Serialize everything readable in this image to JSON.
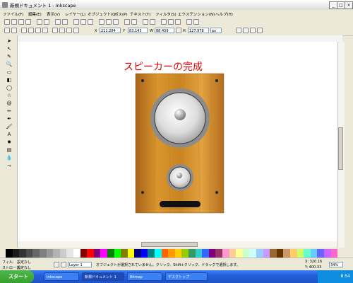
{
  "window": {
    "title": "新規ドキュメント 1 - Inkscape"
  },
  "menu": [
    "ファイル(F)",
    "編集(E)",
    "表示(V)",
    "レイヤー(L)",
    "オブジェクト(O)",
    "パス(P)",
    "テキスト(T)",
    "フィルタ(S)",
    "エクステンション(N)",
    "ヘルプ(H)"
  ],
  "toolbar2": {
    "x_label": "X",
    "x_value": "211.284",
    "y_label": "Y",
    "y_value": "83.143",
    "w_label": "W",
    "w_value": "88.439",
    "h_label": "H",
    "h_value": "127.978",
    "unit": "px"
  },
  "canvas": {
    "heading": "スピーカーの完成"
  },
  "status": {
    "fill_label": "フィル:",
    "fill_value": "設定なし",
    "stroke_label": "ストローク:",
    "stroke_value": "設定なし",
    "layer": "Layer 1",
    "message": "オブジェクトが選択されていません。クリック、Shift+クリック、ドラッグで選択します。",
    "coord_x": "X: 320.16",
    "coord_y": "Y: 400.33",
    "zoom": "34%"
  },
  "taskbar": {
    "start": "スタート",
    "tasks": [
      "Inkscape",
      "新規ドキュメント 1",
      "Bitmap",
      "デスクトップ"
    ],
    "clock": "8:54"
  },
  "palette": [
    "#000000",
    "#1a1a1a",
    "#333333",
    "#4d4d4d",
    "#666666",
    "#808080",
    "#999999",
    "#b3b3b3",
    "#cccccc",
    "#e6e6e6",
    "#ffffff",
    "#800000",
    "#ff0000",
    "#800080",
    "#ff00ff",
    "#008000",
    "#00ff00",
    "#808000",
    "#ffff00",
    "#000080",
    "#0000ff",
    "#008080",
    "#00ffff",
    "#ff6600",
    "#ff9900",
    "#ffcc00",
    "#99cc00",
    "#339966",
    "#33cccc",
    "#3366ff",
    "#800080",
    "#993366",
    "#ff99cc",
    "#ffcc99",
    "#ffff99",
    "#ccffcc",
    "#ccffff",
    "#99ccff",
    "#cc99ff",
    "#996633",
    "#663300",
    "#cc9966",
    "#ffcc66",
    "#ccff66",
    "#66ffcc",
    "#66ccff",
    "#6666ff",
    "#cc66ff",
    "#ff66cc"
  ]
}
